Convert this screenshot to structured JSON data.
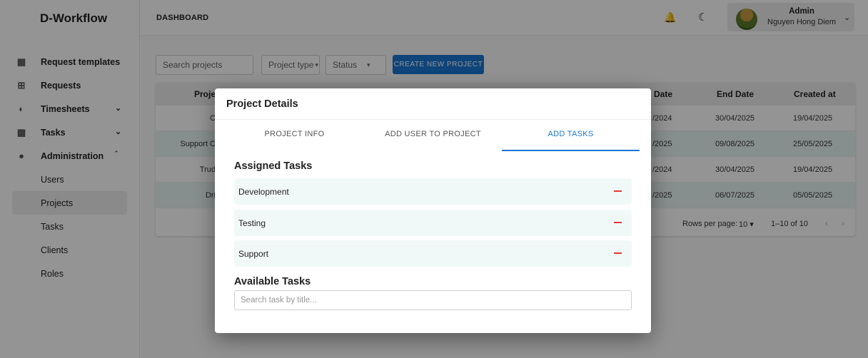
{
  "brand": "D-Workflow",
  "sidebar": {
    "items": [
      {
        "label": "Request templates",
        "icon": "grid-add-icon"
      },
      {
        "label": "Requests",
        "icon": "table-icon"
      },
      {
        "label": "Timesheets",
        "icon": "pie-clock-icon"
      },
      {
        "label": "Tasks",
        "icon": "tasks-icon"
      },
      {
        "label": "Administration",
        "icon": "admin-icon"
      },
      {
        "label": "Users"
      },
      {
        "label": "Projects"
      },
      {
        "label": "Tasks"
      },
      {
        "label": "Clients"
      },
      {
        "label": "Roles"
      }
    ]
  },
  "header": {
    "title": "DASHBOARD",
    "user_role": "Admin",
    "user_name": "Nguyen Hong Diem"
  },
  "toolbar": {
    "search_placeholder": "Search projects",
    "project_type": "Project type",
    "status": "Status",
    "create_label": "CREATE NEW PROJECT"
  },
  "table": {
    "headers": {
      "project": "Proje",
      "start": "Date",
      "end": "End Date",
      "created": "Created at"
    },
    "rows": [
      {
        "project": "C",
        "start": "/2024",
        "end": "30/04/2025",
        "created": "19/04/2025"
      },
      {
        "project": "Support C",
        "start": "/2025",
        "end": "09/08/2025",
        "created": "25/05/2025"
      },
      {
        "project": "Trud",
        "start": "/2024",
        "end": "30/04/2025",
        "created": "19/04/2025"
      },
      {
        "project": "Dri",
        "start": "/2025",
        "end": "06/07/2025",
        "created": "05/05/2025"
      }
    ],
    "rows_per_page_label": "Rows per page:",
    "rows_per_page": "10",
    "range": "1–10 of 10"
  },
  "modal": {
    "title": "Project Details",
    "tabs": [
      "PROJECT INFO",
      "ADD USER TO PROJECT",
      "ADD TASKS"
    ],
    "assigned_title": "Assigned Tasks",
    "assigned": [
      "Development",
      "Testing",
      "Support"
    ],
    "available_title": "Available Tasks",
    "search_placeholder": "Search task by title..."
  },
  "colors": {
    "accent": "#1976d2",
    "remove": "#e53935"
  }
}
